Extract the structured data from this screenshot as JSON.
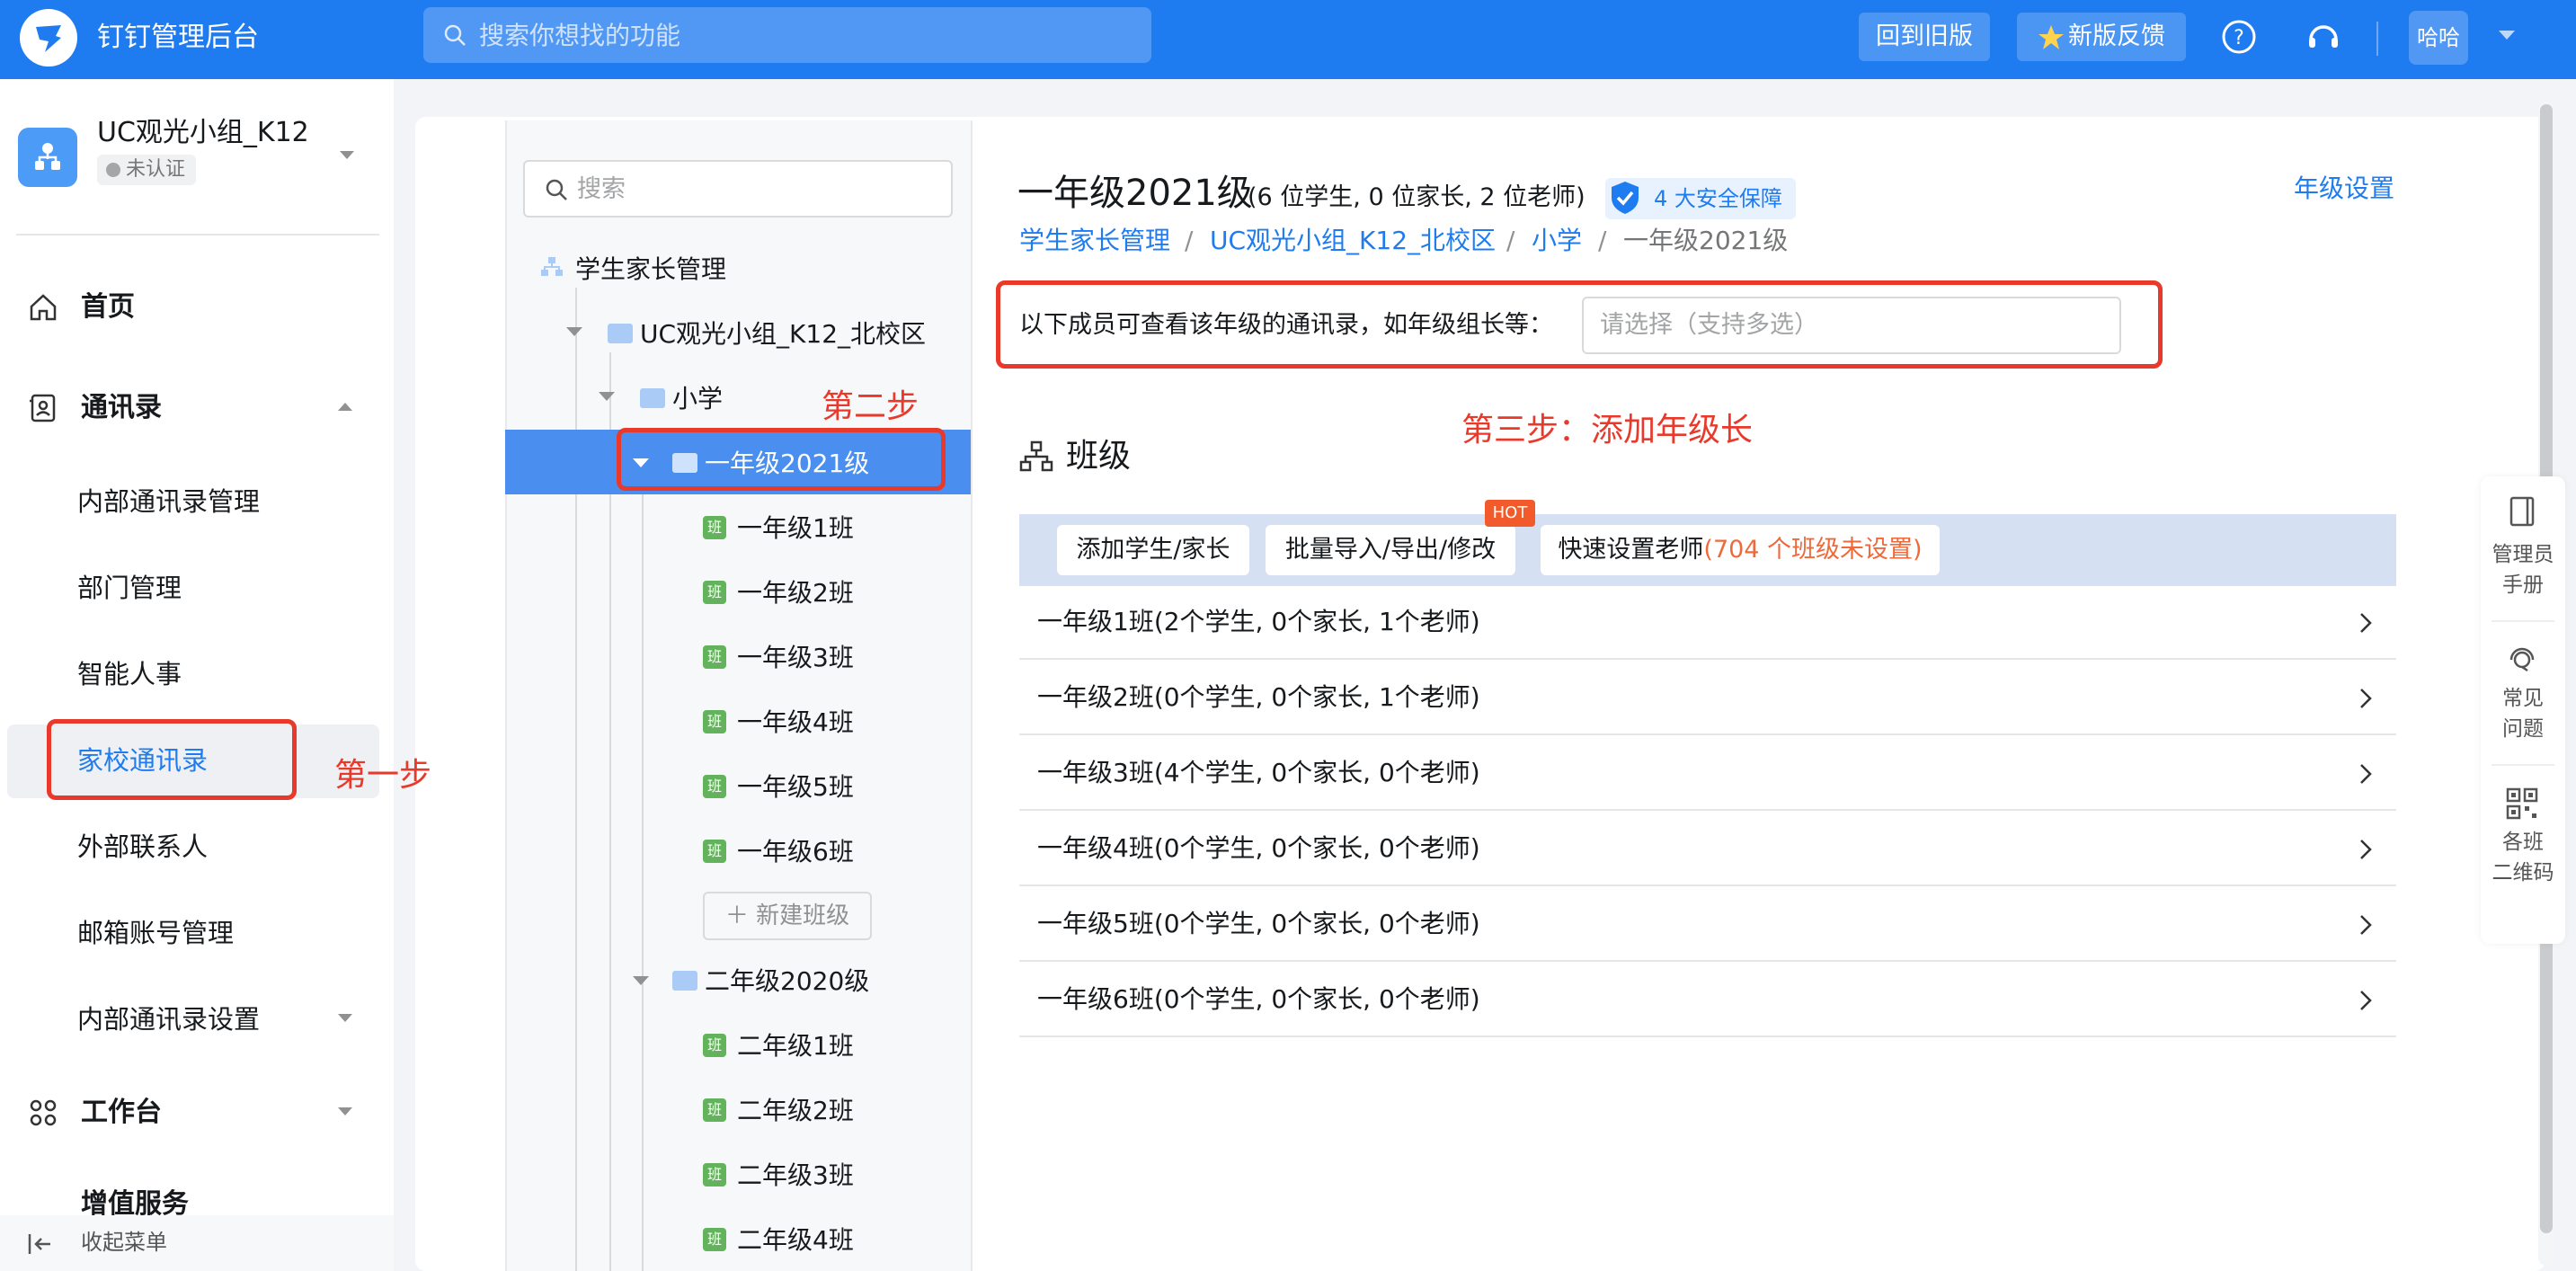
{
  "topbar": {
    "app_title": "钉钉管理后台",
    "search_placeholder": "搜索你想找的功能",
    "back_old_label": "回到旧版",
    "feedback_label": "新版反馈",
    "avatar_label": "哈哈"
  },
  "org": {
    "name": "UC观光小组_K12",
    "badge": "未认证"
  },
  "nav": {
    "home": "首页",
    "contacts": "通讯录",
    "contacts_items": [
      "内部通讯录管理",
      "部门管理",
      "智能人事",
      "家校通讯录",
      "外部联系人",
      "邮箱账号管理",
      "内部通讯录设置"
    ],
    "workbench": "工作台",
    "value_added": "增值服务",
    "collapse": "收起菜单"
  },
  "tree": {
    "search_placeholder": "搜索",
    "root": "学生家长管理",
    "campus": "UC观光小组_K12_北校区",
    "level": "小学",
    "grade1": "一年级2021级",
    "grade1_classes": [
      "一年级1班",
      "一年级2班",
      "一年级3班",
      "一年级4班",
      "一年级5班",
      "一年级6班"
    ],
    "class_badge": "班",
    "new_class": "新建班级",
    "grade2": "二年级2020级",
    "grade2_classes": [
      "二年级1班",
      "二年级2班",
      "二年级3班",
      "二年级4班"
    ]
  },
  "detail": {
    "title": "一年级2021级",
    "summary": "(6 位学生, 0 位家长, 2 位老师)",
    "safety": "4 大安全保障",
    "grade_settings": "年级设置",
    "breadcrumb": [
      "学生家长管理",
      "UC观光小组_K12_北校区",
      "小学",
      "一年级2021级"
    ],
    "breadcrumb_sep": "/",
    "leader_label": "以下成员可查看该年级的通讯录，如年级组长等：",
    "leader_placeholder": "请选择（支持多选）",
    "class_heading": "班级",
    "toolbar": {
      "add": "添加学生/家长",
      "batch": "批量导入/导出/修改",
      "hot": "HOT",
      "quick_set": "快速设置老师",
      "quick_warn": "(704 个班级未设置)"
    },
    "classes": [
      "一年级1班(2个学生, 0个家长, 1个老师)",
      "一年级2班(0个学生, 0个家长, 1个老师)",
      "一年级3班(4个学生, 0个家长, 0个老师)",
      "一年级4班(0个学生, 0个家长, 0个老师)",
      "一年级5班(0个学生, 0个家长, 0个老师)",
      "一年级6班(0个学生, 0个家长, 0个老师)"
    ]
  },
  "float_tools": {
    "manual": [
      "管理员",
      "手册"
    ],
    "faq": [
      "常见",
      "问题"
    ],
    "qrcode": [
      "各班",
      "二维码"
    ]
  },
  "annotations": {
    "step1": "第一步",
    "step2": "第二步",
    "step3": "第三步：添加年级长"
  },
  "colors": {
    "brand": "#1f7cf0",
    "annotation": "#e8392b",
    "selected_tree": "#4a8ff0",
    "warn": "#ef6a3a"
  }
}
